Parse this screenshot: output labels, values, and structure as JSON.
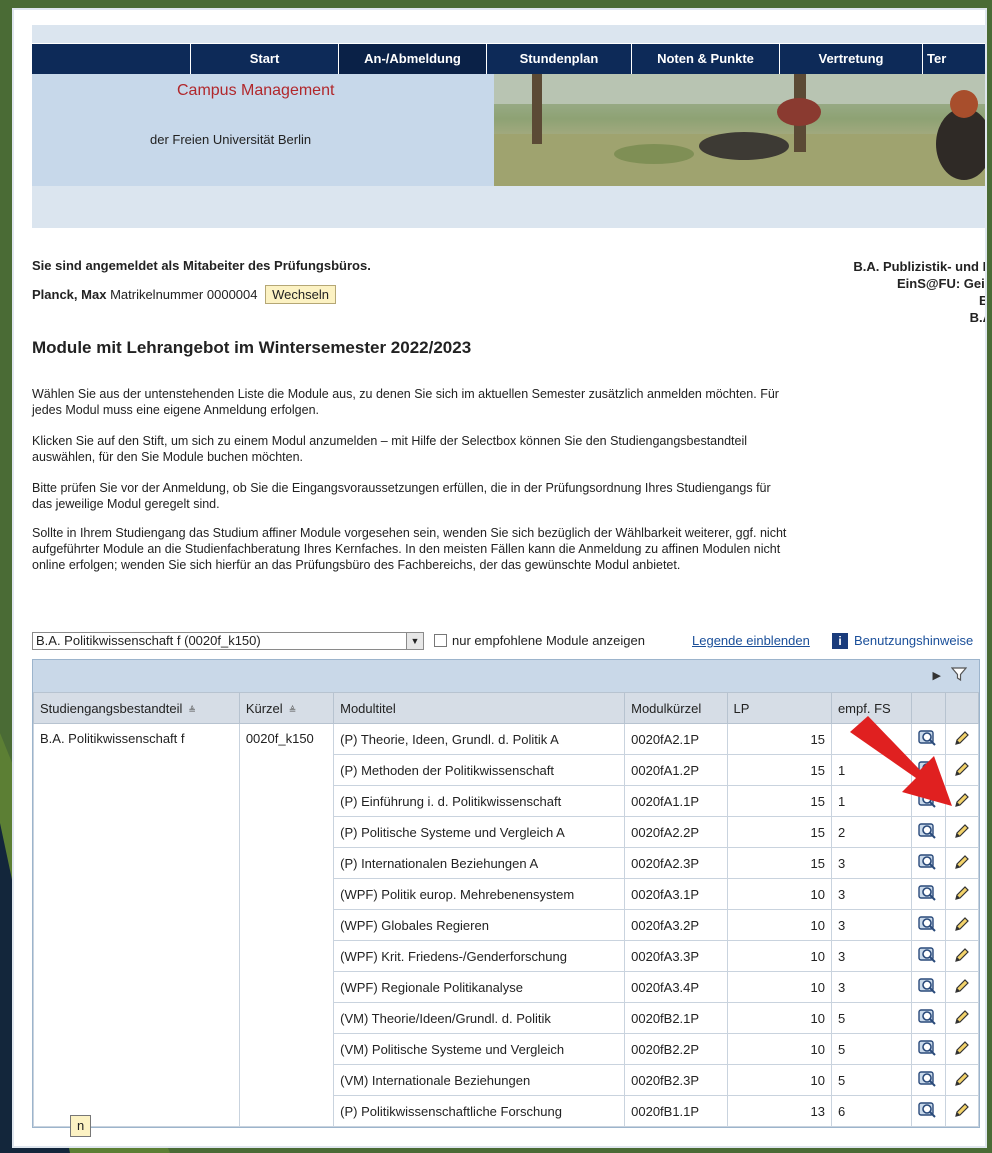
{
  "nav": {
    "items": [
      "Start",
      "An-/Abmeldung",
      "Stundenplan",
      "Noten & Punkte",
      "Vertretung",
      "Ter"
    ]
  },
  "header": {
    "title": "Campus Management",
    "subtitle": "der Freien Universität Berlin"
  },
  "session": {
    "logged_in_text": "Sie sind angemeldet als Mitabeiter des Prüfungsbüros.",
    "name": "Planck, Max",
    "matrikel_label": "Matrikelnummer",
    "matrikel_value": "0000004",
    "switch_button": "Wechseln"
  },
  "right_info": [
    "B.A. Publizistik- und K",
    "EinS@FU: Geis",
    "B.",
    "B.A"
  ],
  "page": {
    "title": "Module mit Lehrangebot im Wintersemester 2022/2023",
    "paragraphs": [
      "Wählen Sie aus der untenstehenden Liste die Module aus, zu denen Sie sich im aktuellen Semester zusätzlich anmelden möchten. Für jedes Modul muss eine eigene Anmeldung erfolgen.",
      "Klicken Sie auf den Stift, um sich zu einem Modul anzumelden – mit Hilfe der Selectbox können Sie den Studiengangsbestandteil auswählen, für den Sie Module buchen möchten.",
      "Bitte prüfen Sie vor der Anmeldung, ob Sie die Eingangsvoraussetzungen erfüllen, die in der Prüfungsordnung Ihres Studiengangs für das jeweilige Modul geregelt sind.",
      "Sollte in Ihrem Studiengang das Studium affiner Module vorgesehen sein, wenden Sie sich bezüglich der Wählbarkeit weiterer, ggf. nicht aufgeführter Module an die Studienfachberatung Ihres Kernfaches. In den meisten Fällen kann die Anmeldung zu affinen Modulen nicht online erfolgen; wenden Sie sich hierfür an das Prüfungsbüro des Fachbereichs, der das gewünschte Modul anbietet."
    ]
  },
  "controls": {
    "select_value": "B.A. Politikwissenschaft f (0020f_k150)",
    "checkbox_label": "nur empfohlene Module anzeigen",
    "legend_link": "Legende einblenden",
    "info_icon": "i",
    "help_link": "Benutzungshinweise"
  },
  "table": {
    "headers": [
      "Studiengangsbestandteil",
      "Kürzel",
      "Modultitel",
      "Modulkürzel",
      "LP",
      "empf. FS"
    ],
    "program": "B.A. Politikwissenschaft f",
    "program_code": "0020f_k150",
    "rows": [
      {
        "title": "(P) Theorie, Ideen, Grundl. d. Politik A",
        "code": "0020fA2.1P",
        "lp": "15",
        "fs": ""
      },
      {
        "title": "(P) Methoden der Politikwissenschaft",
        "code": "0020fA1.2P",
        "lp": "15",
        "fs": "1"
      },
      {
        "title": "(P) Einführung i. d. Politikwissenschaft",
        "code": "0020fA1.1P",
        "lp": "15",
        "fs": "1"
      },
      {
        "title": "(P) Politische Systeme und Vergleich A",
        "code": "0020fA2.2P",
        "lp": "15",
        "fs": "2"
      },
      {
        "title": "(P) Internationalen Beziehungen A",
        "code": "0020fA2.3P",
        "lp": "15",
        "fs": "3"
      },
      {
        "title": "(WPF) Politik europ. Mehrebenensystem",
        "code": "0020fA3.1P",
        "lp": "10",
        "fs": "3"
      },
      {
        "title": "(WPF) Globales Regieren",
        "code": "0020fA3.2P",
        "lp": "10",
        "fs": "3"
      },
      {
        "title": "(WPF) Krit. Friedens-/Genderforschung",
        "code": "0020fA3.3P",
        "lp": "10",
        "fs": "3"
      },
      {
        "title": "(WPF) Regionale Politikanalyse",
        "code": "0020fA3.4P",
        "lp": "10",
        "fs": "3"
      },
      {
        "title": "(VM) Theorie/Ideen/Grundl. d. Politik",
        "code": "0020fB2.1P",
        "lp": "10",
        "fs": "5"
      },
      {
        "title": "(VM) Politische Systeme und Vergleich",
        "code": "0020fB2.2P",
        "lp": "10",
        "fs": "5"
      },
      {
        "title": "(VM) Internationale Beziehungen",
        "code": "0020fB2.3P",
        "lp": "10",
        "fs": "5"
      },
      {
        "title": "(P) Politikwissenschaftliche Forschung",
        "code": "0020fB1.1P",
        "lp": "13",
        "fs": "6"
      }
    ]
  },
  "bottom_button": "n",
  "colors": {
    "nav_bg": "#0d2a58",
    "header_bg": "#c7d8ea",
    "campus_red": "#b1272b",
    "link_blue": "#1a4f9a",
    "arrow_red": "#e02020"
  }
}
